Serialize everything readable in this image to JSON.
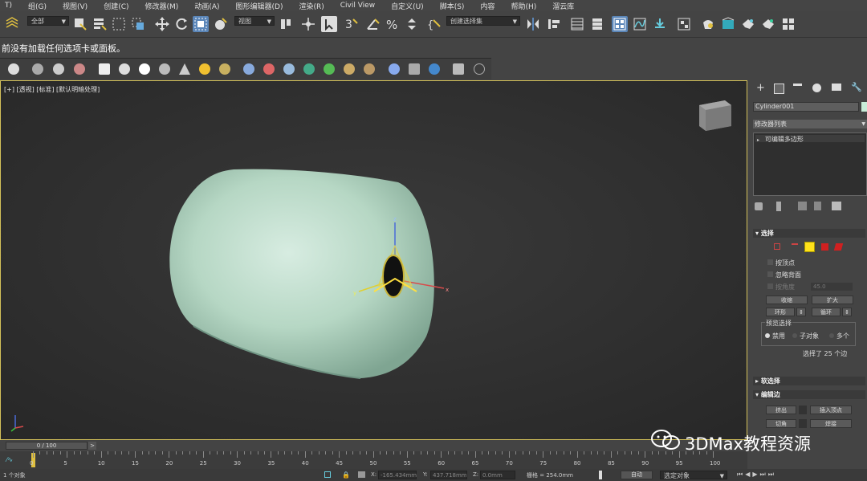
{
  "menu": [
    "T)",
    "组(G)",
    "视图(V)",
    "创建(C)",
    "修改器(M)",
    "动画(A)",
    "图形编辑器(D)",
    "渲染(R)",
    "Civil View",
    "自定义(U)",
    "脚本(S)",
    "内容",
    "帮助(H)",
    "溜云库"
  ],
  "toolbar": {
    "filter_value": "全部",
    "view_value": "视图",
    "selection_set_placeholder": "创建选择集"
  },
  "notice": "前没有加载任何选项卡或面板。",
  "viewport": {
    "label": "[+] [透视] [标准] [默认明暗处理]",
    "gizmo_x": "x",
    "gizmo_y": "y",
    "gizmo_z": "z"
  },
  "command_panel": {
    "object_name": "Cylinder001",
    "modifier_list": "修改器列表",
    "stack_item": "可编辑多边形",
    "selection_rollout": "选择",
    "by_vertex": "按顶点",
    "ignore_backfacing": "忽略背面",
    "angle_label": "按角度",
    "angle_value": "45.0",
    "shrink": "收缩",
    "grow": "扩大",
    "ring": "环形",
    "loop": "循环",
    "preview_selection": "预览选择",
    "preview_off": "禁用",
    "preview_subobj": "子对象",
    "preview_multi": "多个",
    "selected_count": "选择了 25 个边",
    "soft_selection": "软选择",
    "edit_edges": "编辑边",
    "extrude": "挤出",
    "insert_vertex": "插入顶点",
    "chamfer": "切角",
    "weld": "焊接"
  },
  "timeline": {
    "frame_counter": "0 / 100",
    "ticks": [
      "0",
      "5",
      "10",
      "15",
      "20",
      "25",
      "30",
      "35",
      "40",
      "45",
      "50",
      "55",
      "60",
      "65",
      "70",
      "75",
      "80",
      "85",
      "90",
      "95",
      "100"
    ]
  },
  "status": {
    "objects": "1 个对象",
    "x_label": "X:",
    "x_value": "-165.434mm",
    "y_label": "Y:",
    "y_value": "437.718mm",
    "z_label": "Z:",
    "z_value": "0.0mm",
    "grid": "栅格 = 254.0mm",
    "auto": "自动",
    "selected_object": "选定对象"
  },
  "watermark": "3DMax教程资源"
}
